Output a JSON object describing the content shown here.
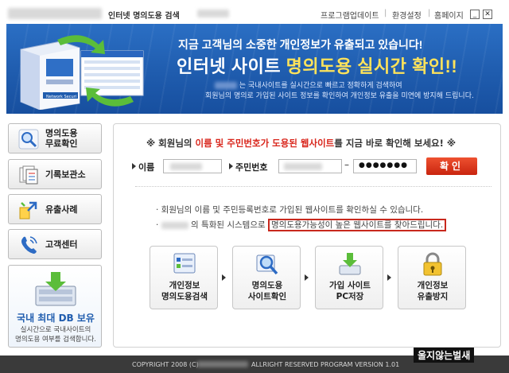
{
  "titlebar": {
    "title": "인터넷 명의도용 검색",
    "links": [
      "프로그램업데이트",
      "환경설정",
      "홈페이지"
    ]
  },
  "banner": {
    "headline1": "지금 고객님의 소중한 개인정보가 유출되고 있습니다!",
    "headline2_a": "인터넷 사이트 ",
    "headline2_b": "명의도용 실시간 확인!!",
    "sub1": "는 국내사이트를 실시간으로 빠르고 정확하게 검색하여",
    "sub2": "회원님의 명의로 가입된 사이트 정보를 확인하여 개인정보 유출을 미연에 방지해 드립니다."
  },
  "sidebar": {
    "items": [
      {
        "label1": "명의도용",
        "label2": "무료확인",
        "icon": "magnifier-icon"
      },
      {
        "label1": "기록보관소",
        "label2": "",
        "icon": "documents-icon"
      },
      {
        "label1": "유출사례",
        "label2": "",
        "icon": "arrows-icon"
      },
      {
        "label1": "고객센터",
        "label2": "",
        "icon": "phone-icon"
      }
    ],
    "db_title": "국내 최대 DB 보유",
    "db_sub1": "실시간으로 국내사이트의",
    "db_sub2": "명의도용 여부를 검색합니다."
  },
  "form": {
    "headline_pre": "※ 회원님의 ",
    "headline_red": "이름 및 주민번호가 도용된 웹사이트",
    "headline_post": "를 지금 바로 확인해 보세요! ※",
    "name_label": "이름",
    "ssn_label": "주민번호",
    "ssn_dash": "–",
    "ssn_mask": "●●●●●●●",
    "confirm_label": "확인"
  },
  "info": {
    "line1": "· 회원님의 이름 및 주민등록번호로 가입된 웹사이트를 확인하실 수 있습니다.",
    "line2_pre": "의 특화된 시스템으로",
    "line2_hl": "명의도용가능성이 높은 웹사이트를 찾아드립니다."
  },
  "steps": [
    {
      "l1": "개인정보",
      "l2": "명의도용검색"
    },
    {
      "l1": "명의도용",
      "l2": "사이트확인"
    },
    {
      "l1": "가입 사이트",
      "l2": "PC저장"
    },
    {
      "l1": "개인정보",
      "l2": "유출방지"
    }
  ],
  "footer": {
    "left": "COPYRIGHT 2008 (C)",
    "right": "ALLRIGHT RESERVED PROGRAM VERSION 1.01",
    "watermark": "울지않는벌새"
  }
}
